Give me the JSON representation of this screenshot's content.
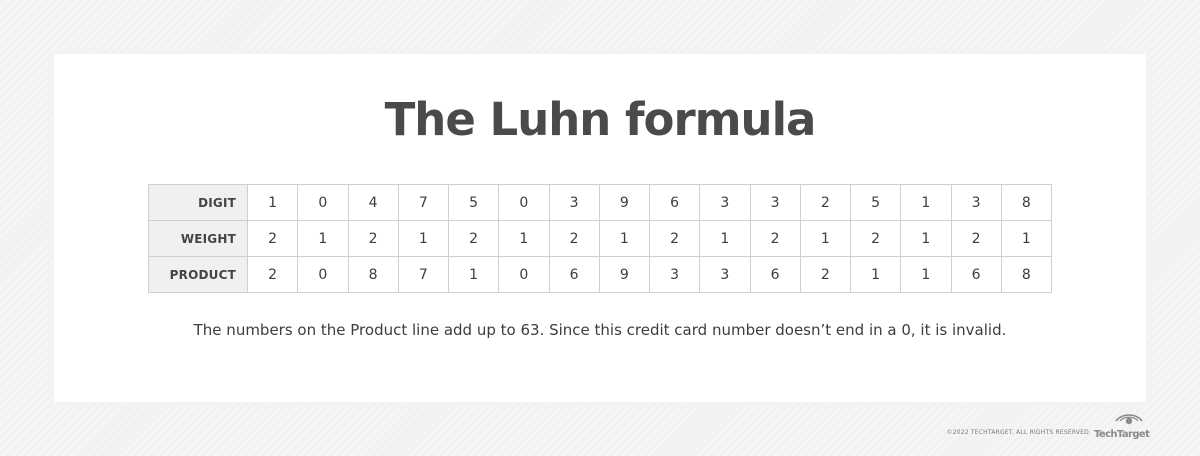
{
  "title": "The Luhn formula",
  "table": {
    "rows": [
      {
        "label": "DIGIT",
        "values": [
          "1",
          "0",
          "4",
          "7",
          "5",
          "0",
          "3",
          "9",
          "6",
          "3",
          "3",
          "2",
          "5",
          "1",
          "3",
          "8"
        ]
      },
      {
        "label": "WEIGHT",
        "values": [
          "2",
          "1",
          "2",
          "1",
          "2",
          "1",
          "2",
          "1",
          "2",
          "1",
          "2",
          "1",
          "2",
          "1",
          "2",
          "1"
        ]
      },
      {
        "label": "PRODUCT",
        "values": [
          "2",
          "0",
          "8",
          "7",
          "1",
          "0",
          "6",
          "9",
          "3",
          "3",
          "6",
          "2",
          "1",
          "1",
          "6",
          "8"
        ]
      }
    ]
  },
  "caption": "The numbers on the Product line add up to 63. Since this credit card number doesn’t end in a 0, it is invalid.",
  "footer": {
    "copyright": "©2022 TECHTARGET. ALL RIGHTS RESERVED",
    "logo_text": "TechTarget"
  }
}
